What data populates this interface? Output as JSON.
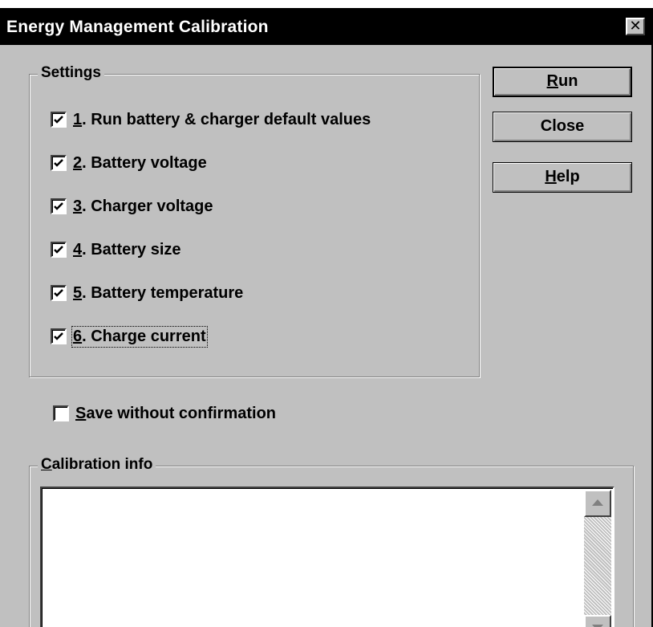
{
  "window": {
    "title": "Energy Management Calibration",
    "close_glyph": "✕"
  },
  "settings": {
    "legend": "Settings",
    "items": [
      {
        "num": "1",
        "label": ". Run battery & charger default values",
        "checked": true
      },
      {
        "num": "2",
        "label": ". Battery voltage",
        "checked": true
      },
      {
        "num": "3",
        "label": ". Charger voltage",
        "checked": true
      },
      {
        "num": "4",
        "label": ". Battery size",
        "checked": true
      },
      {
        "num": "5",
        "label": ". Battery temperature",
        "checked": true
      },
      {
        "num": "6",
        "label": ". Charge current",
        "checked": true
      }
    ]
  },
  "buttons": {
    "run": {
      "mnemonic": "R",
      "rest": "un"
    },
    "close": {
      "label": "Close"
    },
    "help": {
      "mnemonic": "H",
      "rest": "elp"
    }
  },
  "save_option": {
    "mnemonic": "S",
    "rest": "ave without confirmation",
    "checked": false
  },
  "calibration_info": {
    "legend_mnemonic": "C",
    "legend_rest": "alibration info",
    "text": ""
  },
  "icons": {
    "check": "check-mark-icon",
    "scroll_up": "scroll-up-arrow-icon",
    "scroll_down": "scroll-down-arrow-icon"
  }
}
